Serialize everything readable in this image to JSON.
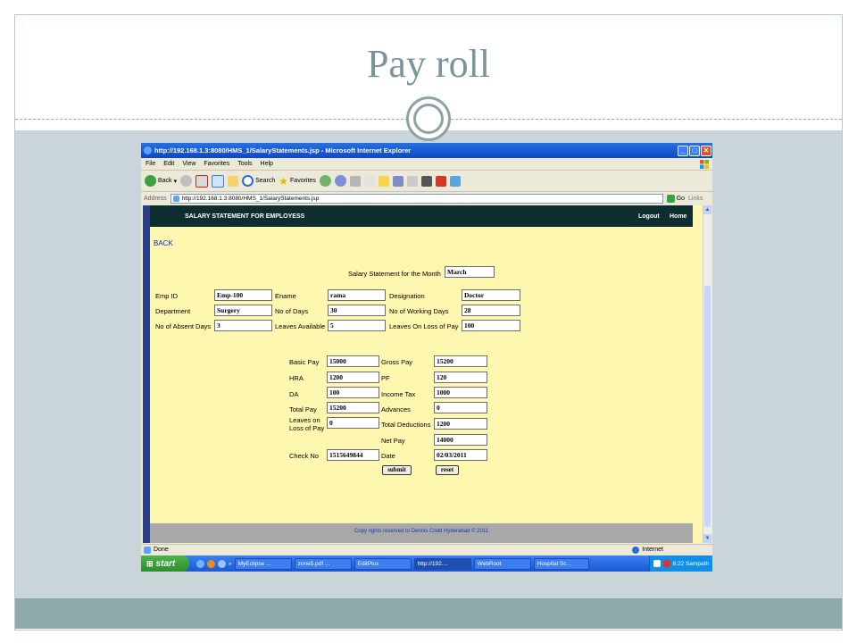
{
  "slide": {
    "title": "Pay roll"
  },
  "browser": {
    "window_title": "http://192.168.1.3:8080/HMS_1/SalaryStatements.jsp - Microsoft Internet Explorer",
    "menu": [
      "File",
      "Edit",
      "View",
      "Favorites",
      "Tools",
      "Help"
    ],
    "toolbar": {
      "back": "Back",
      "search": "Search",
      "favorites": "Favorites"
    },
    "address_label": "Address",
    "address_url": "http://192.168.1.3:8080/HMS_1/SalaryStatements.jsp",
    "go_label": "Go",
    "links_label": "Links",
    "status_text": "Done",
    "zone_text": "Internet"
  },
  "app": {
    "header_title": "SALARY STATEMENT FOR EMPLOYESS",
    "logout": "Logout",
    "home": "Home",
    "back": "BACK",
    "month_label": "Salary Statement for the Month",
    "month_value": "March",
    "employee": {
      "emp_id_label": "Emp ID",
      "emp_id": "Emp-100",
      "ename_label": "Ename",
      "ename": "rama",
      "designation_label": "Designation",
      "designation": "Doctor",
      "department_label": "Department",
      "department": "Surgery",
      "no_of_days_label": "No of Days",
      "no_of_days": "30",
      "working_days_label": "No of Working Days",
      "working_days": "28",
      "absent_days_label": "No of Absent Days",
      "absent_days": "3",
      "leaves_available_label": "Leaves Available",
      "leaves_available": "5",
      "leaves_lop_label": "Leaves On Loss of Pay",
      "leaves_lop": "100"
    },
    "salary": {
      "basic_pay_label": "Basic Pay",
      "basic_pay": "15000",
      "hra_label": "HRA",
      "hra": "1200",
      "da_label": "DA",
      "da": "100",
      "total_pay_label": "Total Pay",
      "total_pay": "15200",
      "leaves_lop_label_1": "Leaves on",
      "leaves_lop_label_2": "Loss of Pay",
      "leaves_lop": "0",
      "check_no_label": "Check No",
      "check_no": "1515649844",
      "gross_pay_label": "Gross Pay",
      "gross_pay": "15200",
      "pf_label": "PF",
      "pf": "120",
      "income_tax_label": "Income Tax",
      "income_tax": "1000",
      "advances_label": "Advances",
      "advances": "0",
      "total_deductions_label": "Total Deductions",
      "total_deductions": "1200",
      "net_pay_label": "Net Pay",
      "net_pay": "14000",
      "date_label": "Date",
      "date": "02/03/2011"
    },
    "submit": "submit",
    "reset": "reset",
    "footer": "Copy rights reserved to Dennis Codd Hyderabad  ©  2011"
  },
  "taskbar": {
    "start": "start",
    "items": [
      "MyEclipse ...",
      "zone5.pdf ...",
      "EditPlus",
      "http://192....",
      "WebRoot",
      "Hospital Sc..."
    ],
    "clock": "8:22 Sampath"
  },
  "colors": {
    "title": "#7a9598",
    "ie_title": "#0a49c8",
    "page_bg": "#fdf7b0",
    "header_bg": "#0d2d2e"
  }
}
